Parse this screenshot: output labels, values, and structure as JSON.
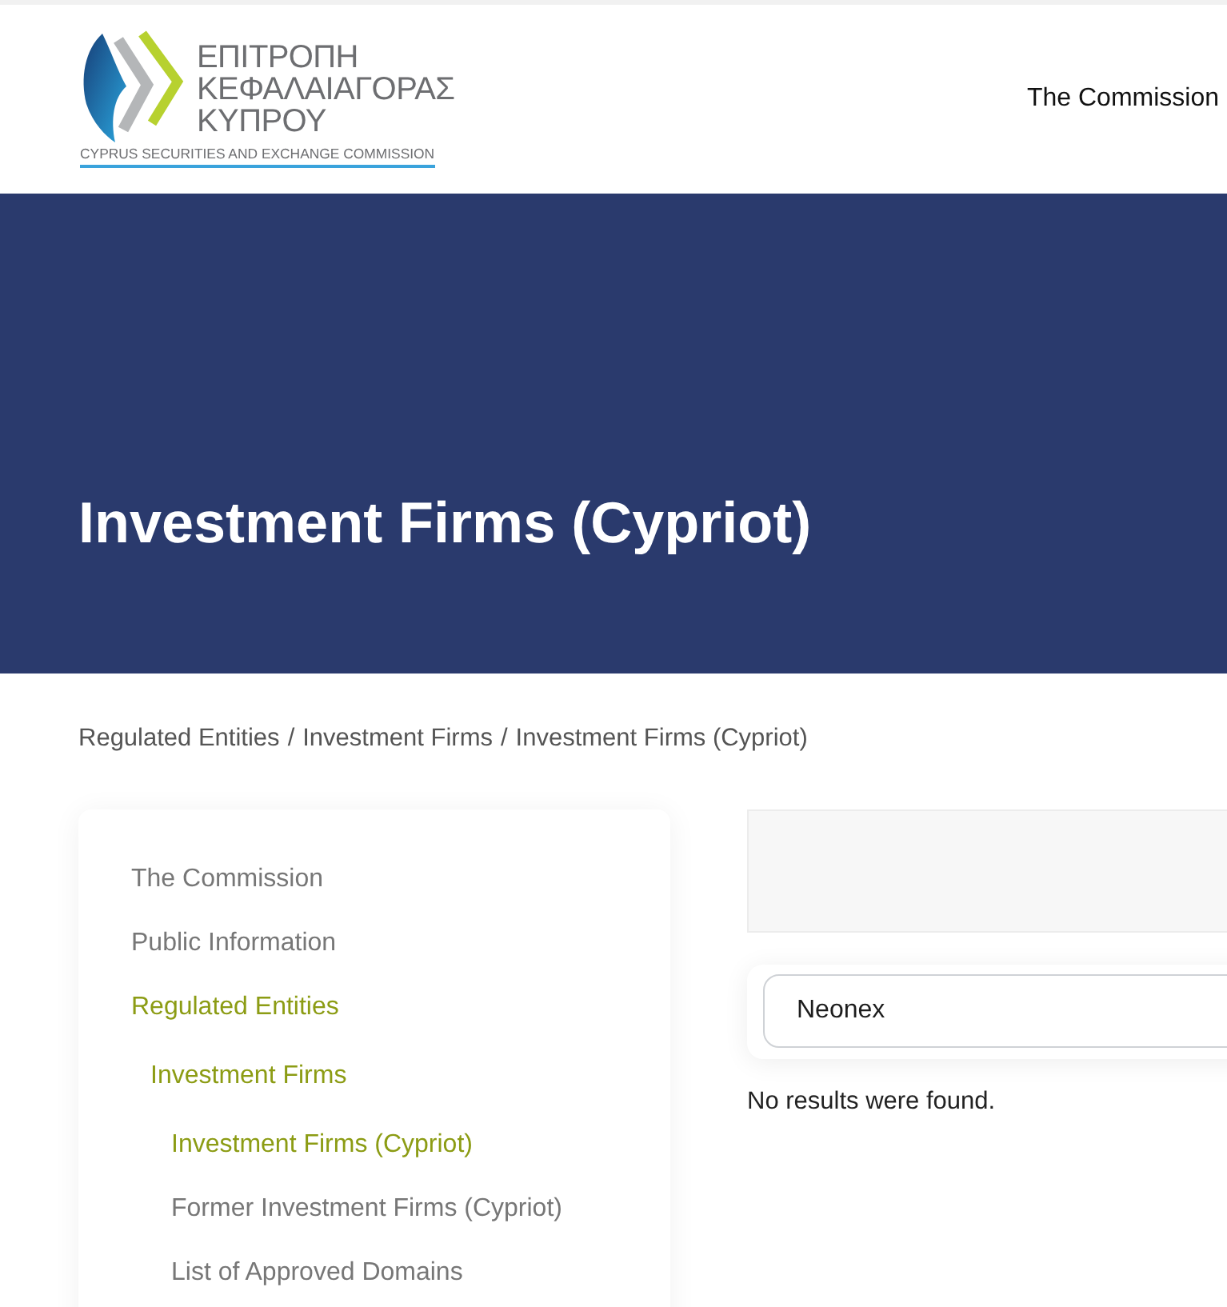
{
  "header": {
    "logo": {
      "lines": [
        "ΕΠΙΤΡΟΠΗ",
        "ΚΕΦΑΛΑΙΑΓΟΡΑΣ",
        "ΚΥΠΡΟΥ"
      ],
      "tagline": "CYPRUS SECURITIES AND EXCHANGE COMMISSION"
    },
    "nav": [
      {
        "label": "The Commission"
      }
    ]
  },
  "hero": {
    "title": "Investment Firms (Cypriot)"
  },
  "breadcrumb": {
    "separator": "/",
    "items": [
      "Regulated Entities",
      "Investment Firms",
      "Investment Firms (Cypriot)"
    ]
  },
  "sidebar": {
    "items": [
      {
        "label": "The Commission",
        "selected": false
      },
      {
        "label": "Public Information",
        "selected": false
      },
      {
        "label": "Regulated Entities",
        "selected": true,
        "children": [
          {
            "label": "Investment Firms",
            "selected": true,
            "children": [
              {
                "label": "Investment Firms (Cypriot)",
                "selected": true
              },
              {
                "label": "Former Investment Firms (Cypriot)",
                "selected": false
              },
              {
                "label": "List of Approved Domains",
                "selected": false
              }
            ]
          }
        ]
      }
    ]
  },
  "search": {
    "value": "Neonex"
  },
  "results": {
    "message": "No results were found."
  }
}
